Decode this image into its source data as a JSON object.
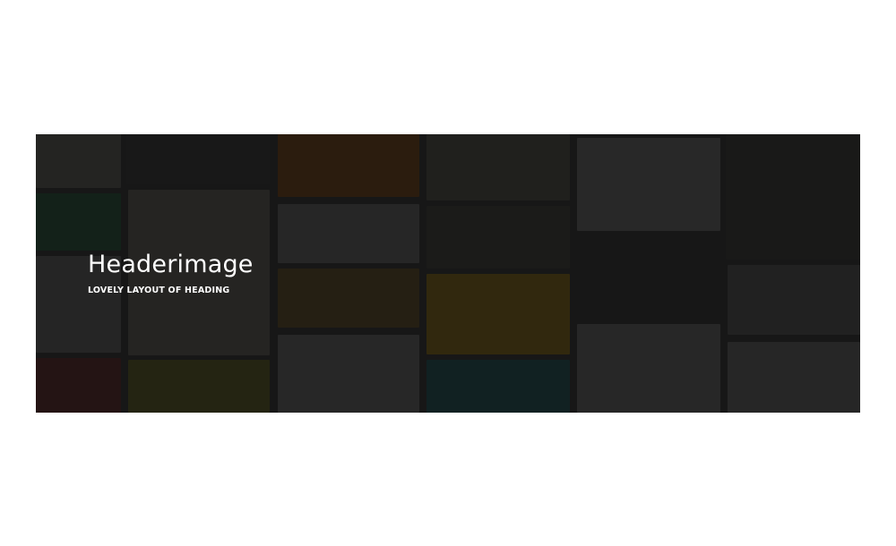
{
  "header": {
    "title": "Headerimage",
    "subtitle": "LOVELY LAYOUT OF HEADING"
  },
  "colors": {
    "page_background": "#ffffff",
    "banner_background": "#1a1a1a",
    "heading_text": "#ffffff"
  },
  "collage": {
    "description_items": [
      "photo-thumbnail",
      "layout-thumbnail-green",
      "layout-thumbnail-red",
      "layout-thumbnail-portrait",
      "layout-thumbnail-orange",
      "layout-thumbnail-gray",
      "layout-thumbnail-olive",
      "layout-thumbnail-light",
      "layout-thumbnail-yellow",
      "layout-thumbnail-teal",
      "layout-thumbnail-dark"
    ]
  }
}
